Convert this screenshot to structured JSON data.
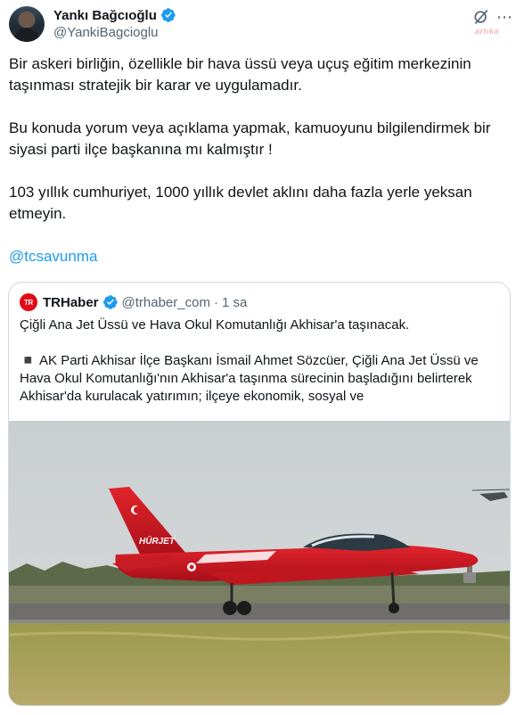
{
  "tweet": {
    "author": {
      "display_name": "Yankı Bağcıoğlu",
      "handle": "@YankiBagcioglu",
      "verified": true
    },
    "watermark": "artıka",
    "text": {
      "p1": "Bir askeri birliğin, özellikle bir hava üssü veya uçuş eğitim merkezinin taşınması stratejik bir karar ve uygulamadır.",
      "p2": "Bu konuda yorum veya açıklama yapmak, kamuoyunu bilgilendirmek bir siyasi parti ilçe başkanına mı kalmıştır !",
      "p3": "103 yıllık cumhuriyet, 1000 yıllık devlet aklını daha fazla yerle yeksan etmeyin.",
      "mention": "@tcsavunma"
    },
    "icons": {
      "grok": "grok-icon",
      "more": "more-icon",
      "verified": "verified-badge-icon"
    },
    "colors": {
      "link": "#1d9bf0",
      "secondary_text": "#536471",
      "border": "#cfd9de",
      "brand_red": "#e30a17"
    }
  },
  "quote": {
    "avatar_text": "TR",
    "display_name": "TRHaber",
    "verified": true,
    "handle": "@trhaber_com",
    "separator": "·",
    "time": "1 sa",
    "line1": "Çiğli Ana Jet Üssü ve Hava Okul Komutanlığı Akhisar'a taşınacak.",
    "line2": "◾️ AK Parti Akhisar İlçe Başkanı İsmail Ahmet Sözcüer, Çiğli Ana Jet Üssü ve Hava Okul Komutanlığı'nın Akhisar'a taşınma sürecinin başladığını belirterek Akhisar'da kurulacak yatırımın; ilçeye ekonomik, sosyal ve",
    "image": {
      "aircraft_tail_text": "HÜRJET",
      "description_icon": "jet-photo"
    }
  }
}
